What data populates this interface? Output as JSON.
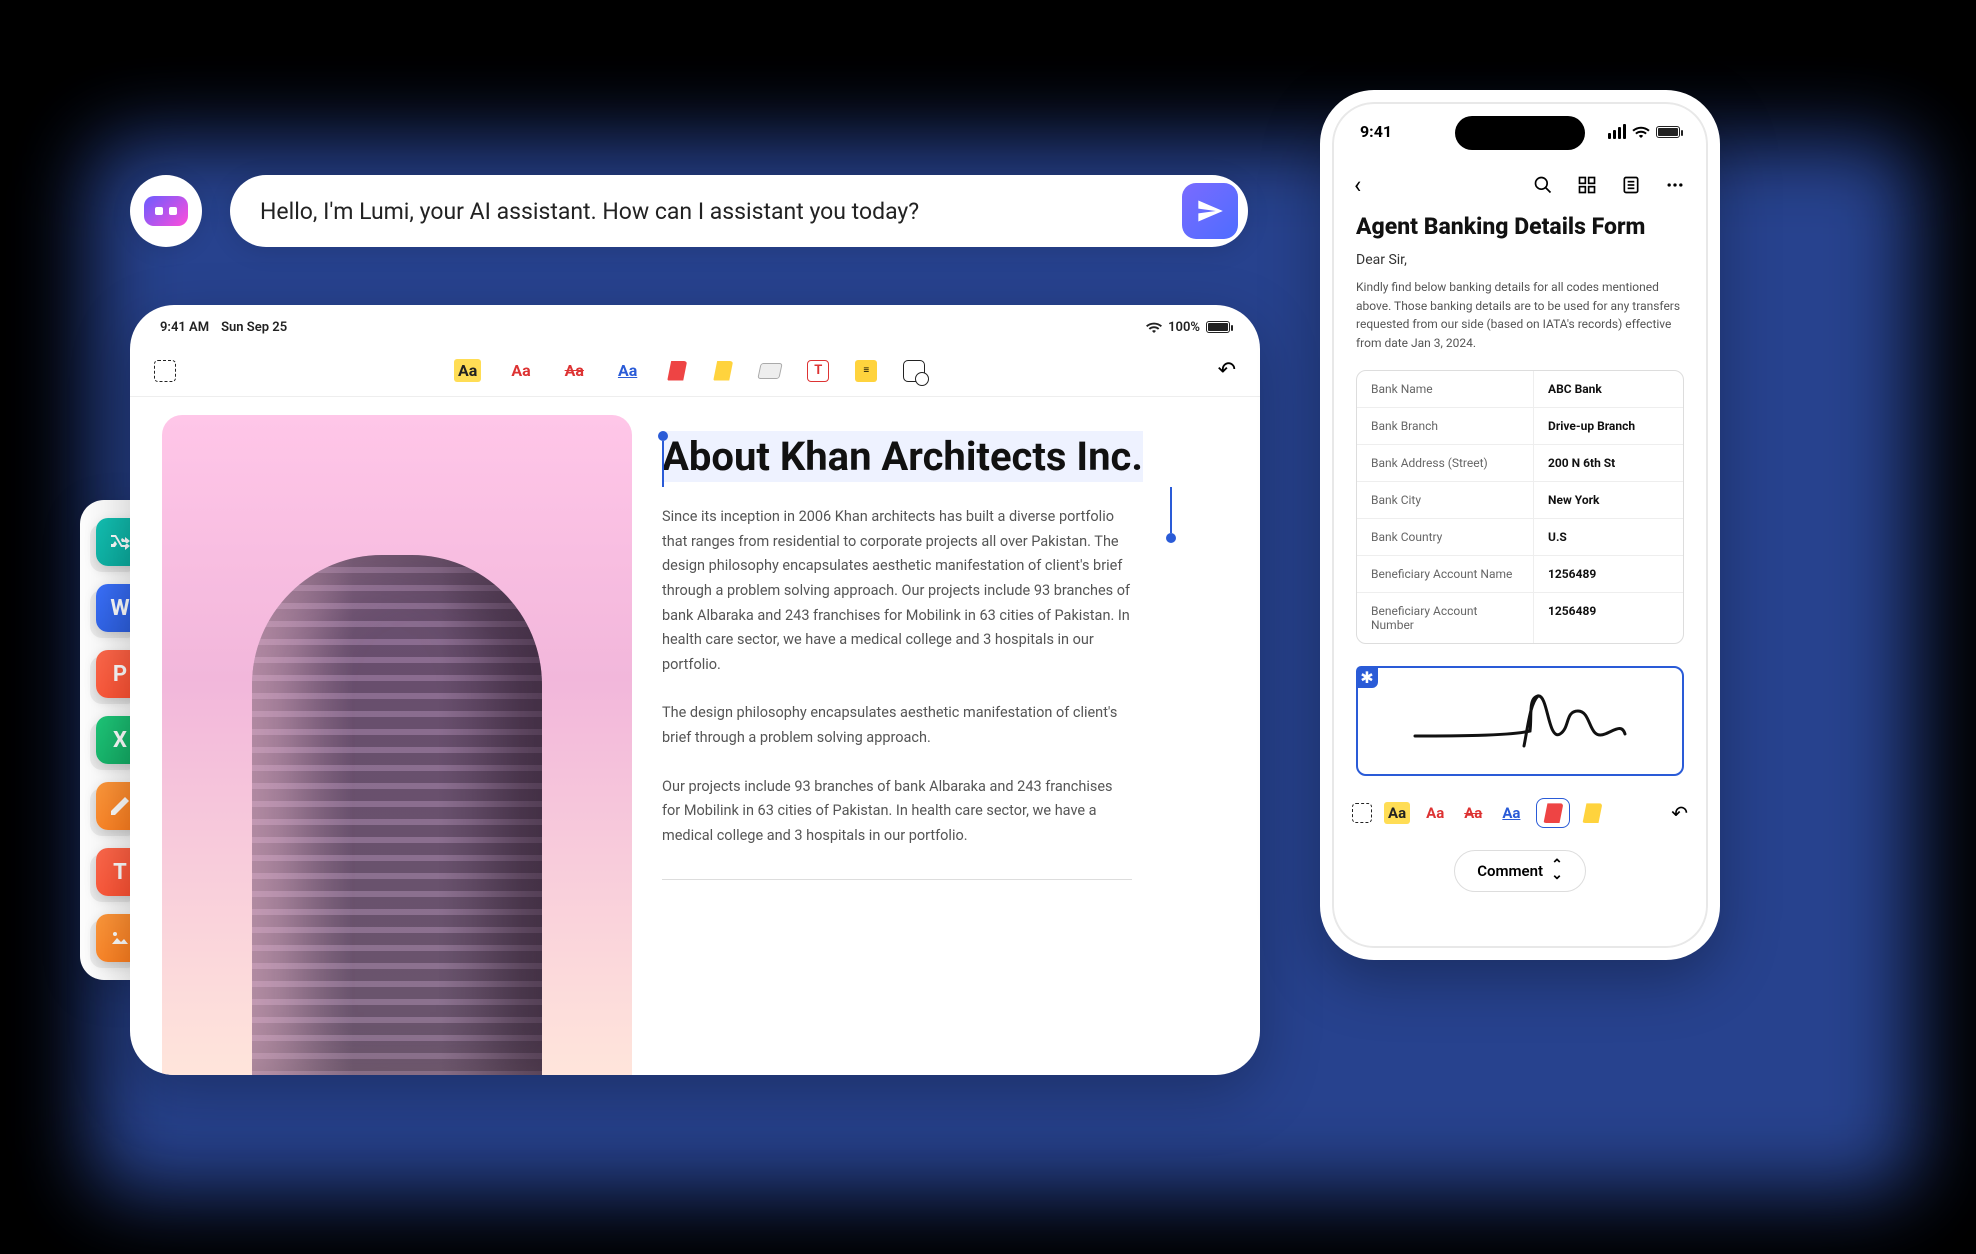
{
  "ai": {
    "greeting": "Hello, I'm Lumi, your AI assistant. How can I assistant you today?"
  },
  "tablet": {
    "status": {
      "time": "9:41 AM",
      "date": "Sun Sep 25",
      "battery": "100%"
    },
    "article": {
      "title": "About Khan Architects Inc.",
      "p1": "Since its inception in 2006 Khan architects has built a diverse portfolio that ranges from residential to corporate projects all over Pakistan. The design philosophy encapsulates aesthetic manifestation of client's brief through a problem solving approach. Our projects include 93 branches of bank Albaraka and 243 franchises for Mobilink in 63 cities of Pakistan. In health care sector, we have a medical college and 3 hospitals in our portfolio.",
      "p2": "The design philosophy encapsulates aesthetic manifestation of client's brief through a problem solving approach.",
      "p3": "Our projects include 93 branches of bank Albaraka and 243 franchises for Mobilink in 63 cities of Pakistan. In health care sector, we have a medical college and 3 hospitals in our portfolio."
    },
    "tools": {
      "aa": "Aa",
      "t": "T",
      "note_glyph": "≡"
    }
  },
  "dock": {
    "apps": [
      {
        "name": "shuffle",
        "letter": "",
        "color1": "#13c2b4",
        "color2": "#0aa79a"
      },
      {
        "name": "word",
        "letter": "W",
        "color1": "#3b72ff",
        "color2": "#2a5bd7"
      },
      {
        "name": "ppt",
        "letter": "P",
        "color1": "#ff6a4d",
        "color2": "#ff4d2e"
      },
      {
        "name": "excel",
        "letter": "X",
        "color1": "#1fc97a",
        "color2": "#12a862"
      },
      {
        "name": "notes",
        "letter": "",
        "color1": "#ff9a3d",
        "color2": "#ff7a1a"
      },
      {
        "name": "text",
        "letter": "T",
        "color1": "#ff6a4d",
        "color2": "#ff4d2e"
      },
      {
        "name": "images",
        "letter": "",
        "color1": "#ff9a3d",
        "color2": "#ff7a1a"
      }
    ]
  },
  "phone": {
    "status_time": "9:41",
    "title": "Agent Banking Details Form",
    "salutation": "Dear Sir,",
    "body": "Kindly find below banking details for all codes mentioned above. Those banking details are to be used for any transfers requested from our side (based on IATA's records) effective from date Jan 3, 2024.",
    "rows": [
      {
        "k": "Bank Name",
        "v": "ABC Bank"
      },
      {
        "k": "Bank Branch",
        "v": "Drive-up Branch"
      },
      {
        "k": "Bank Address (Street)",
        "v": "200 N 6th St"
      },
      {
        "k": "Bank City",
        "v": "New York"
      },
      {
        "k": "Bank Country",
        "v": "U.S"
      },
      {
        "k": "Beneficiary Account Name",
        "v": "1256489"
      },
      {
        "k": "Beneficiary Account Number",
        "v": "1256489"
      }
    ],
    "sig_badge": "✱",
    "comment_label": "Comment",
    "tools_aa": "Aa"
  }
}
